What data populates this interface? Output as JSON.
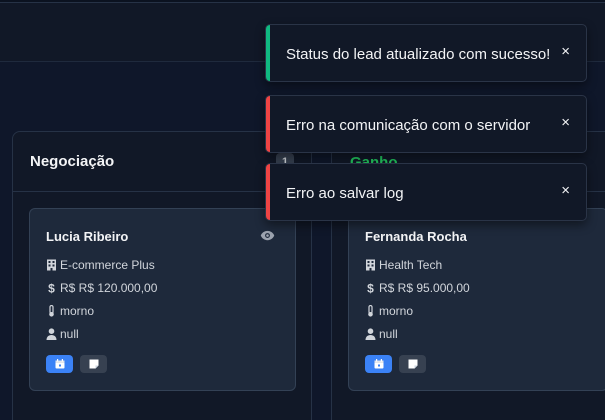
{
  "columns": [
    {
      "title": "Negociação",
      "count": "1",
      "card": {
        "name": "Lucia Ribeiro",
        "company": "E-commerce Plus",
        "value": "R$ R$ 120.000,00",
        "temperature": "morno",
        "owner": "null"
      }
    },
    {
      "title": "Ganho",
      "card": {
        "name": "Fernanda Rocha",
        "company": "Health Tech",
        "value": "R$ R$ 95.000,00",
        "temperature": "morno",
        "owner": "null"
      }
    }
  ],
  "toasts": [
    {
      "type": "success",
      "message": "Status do lead atualizado com sucesso!",
      "close": "×"
    },
    {
      "type": "error",
      "message": "Erro na comunicação com o servidor",
      "close": "×"
    },
    {
      "type": "error",
      "message": "Erro ao salvar log",
      "close": "×"
    }
  ],
  "icons": {
    "company": "building-icon",
    "value": "dollar-icon",
    "temperature": "thermometer-icon",
    "owner": "user-icon",
    "view": "eye-icon",
    "schedule": "calendar-icon",
    "notes": "note-icon"
  },
  "colors": {
    "background": "#0f172a",
    "success": "#10b981",
    "error": "#ef4444",
    "won": "#22c55e",
    "primary_button": "#3b82f6"
  }
}
